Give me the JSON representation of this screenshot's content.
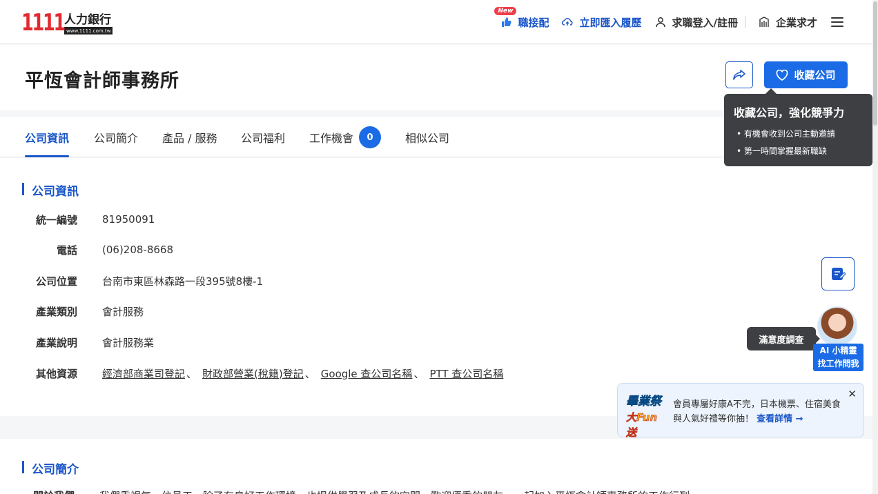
{
  "header": {
    "logo_number": "1111",
    "logo_brand": "人力銀行",
    "logo_url": "www.1111.com.tw",
    "new_badge": "New",
    "nav": {
      "job_match": "職接配",
      "import_resume": "立即匯入履歷",
      "login": "求職登入/註冊",
      "employer": "企業求才"
    }
  },
  "company": {
    "title": "平恆會計師事務所",
    "favorite_label": "收藏公司"
  },
  "tooltip": {
    "title": "收藏公司，強化競爭力",
    "items": [
      "有機會收到公司主動邀請",
      "第一時間掌握最新職缺"
    ]
  },
  "tabs": [
    {
      "label": "公司資訊"
    },
    {
      "label": "公司簡介"
    },
    {
      "label": "產品 / 服務"
    },
    {
      "label": "公司福利"
    },
    {
      "label": "工作機會",
      "count": "0"
    },
    {
      "label": "相似公司"
    }
  ],
  "info_section": {
    "title": "公司資訊",
    "rows": [
      {
        "label": "統一編號",
        "value": "81950091"
      },
      {
        "label": "電話",
        "value": "(06)208-8668"
      },
      {
        "label": "公司位置",
        "value": "台南市東區林森路一段395號8樓-1"
      },
      {
        "label": "產業類別",
        "value": "會計服務"
      },
      {
        "label": "產業說明",
        "value": "會計服務業"
      },
      {
        "label": "其他資源",
        "links": [
          "經濟部商業司登記",
          "財政部營業(稅籍)登記",
          "Google 查公司名稱",
          "PTT 查公司名稱"
        ],
        "separator": "、"
      }
    ]
  },
  "intro_section": {
    "title": "公司簡介",
    "row_label": "關於我們",
    "row_value": "我們重視每一位員工，除了有良好工作環境，也提供學習及成長的空間，歡迎優秀的朋友，一起加入平恆會計師事務所的工作行列"
  },
  "floating": {
    "survey_label": "滿意度調查",
    "ai_line1": "AI 小精靈",
    "ai_line2": "找工作問我"
  },
  "promo": {
    "art_line1": "畢業祭",
    "art_line2": "大Fun送",
    "text": "會員專屬好康A不完，日本機票、住宿美食與人氣好禮等你抽！",
    "link": "查看詳情 →",
    "close": "✕"
  }
}
